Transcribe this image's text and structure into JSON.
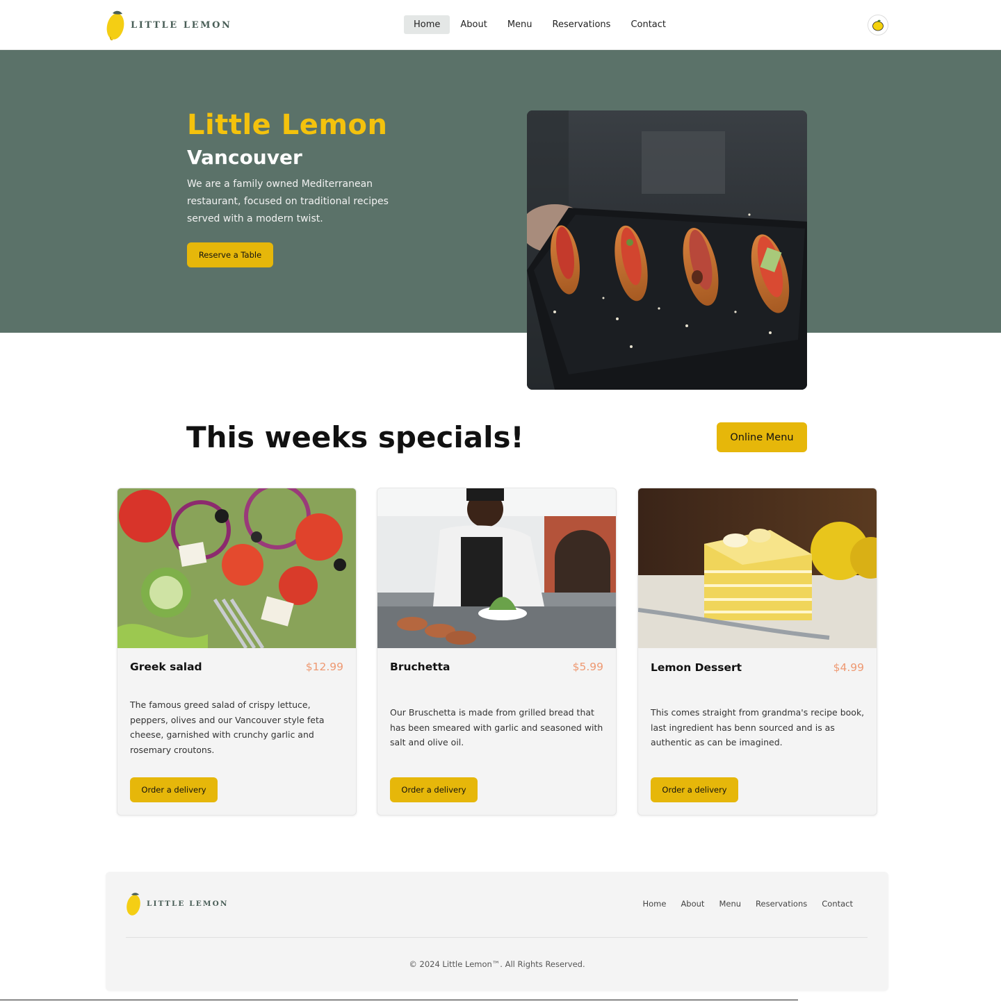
{
  "header": {
    "logo_text": "LITTLE LEMON",
    "nav": [
      {
        "label": "Home",
        "active": true
      },
      {
        "label": "About",
        "active": false
      },
      {
        "label": "Menu",
        "active": false
      },
      {
        "label": "Reservations",
        "active": false
      },
      {
        "label": "Contact",
        "active": false
      }
    ],
    "avatar_icon": "lemon-icon"
  },
  "hero": {
    "title": "Little Lemon",
    "subtitle": "Vancouver",
    "description": "We are a family owned Mediterranean restaurant, focused on traditional recipes served with a modern twist.",
    "cta_label": "Reserve a Table",
    "image_icon": "bruschetta-photo"
  },
  "specials": {
    "title": "This weeks specials!",
    "online_menu_label": "Online Menu",
    "cards": [
      {
        "name": "Greek salad",
        "price": "$12.99",
        "description": "The famous greed salad of crispy lettuce, peppers, olives and our Vancouver style feta cheese, garnished with crunchy garlic and rosemary croutons.",
        "button_label": "Order a delivery",
        "image_icon": "greek-salad-photo"
      },
      {
        "name": "Bruchetta",
        "price": "$5.99",
        "description": "Our Bruschetta is made from grilled bread that has been smeared with garlic and seasoned with salt and olive oil.",
        "button_label": "Order a delivery",
        "image_icon": "chef-photo"
      },
      {
        "name": "Lemon Dessert",
        "price": "$4.99",
        "description": "This comes straight from grandma's recipe book, last ingredient has benn sourced and is as authentic as can be imagined.",
        "button_label": "Order a delivery",
        "image_icon": "lemon-cake-photo"
      }
    ]
  },
  "footer": {
    "logo_text": "LITTLE LEMON",
    "nav": [
      "Home",
      "About",
      "Menu",
      "Reservations",
      "Contact"
    ],
    "copyright": "© 2024 Little Lemon™. All Rights Reserved."
  },
  "colors": {
    "primary_green": "#5b7269",
    "accent_yellow": "#f4c20d",
    "button_yellow": "#e6b70a",
    "price_orange": "#ee9972"
  }
}
